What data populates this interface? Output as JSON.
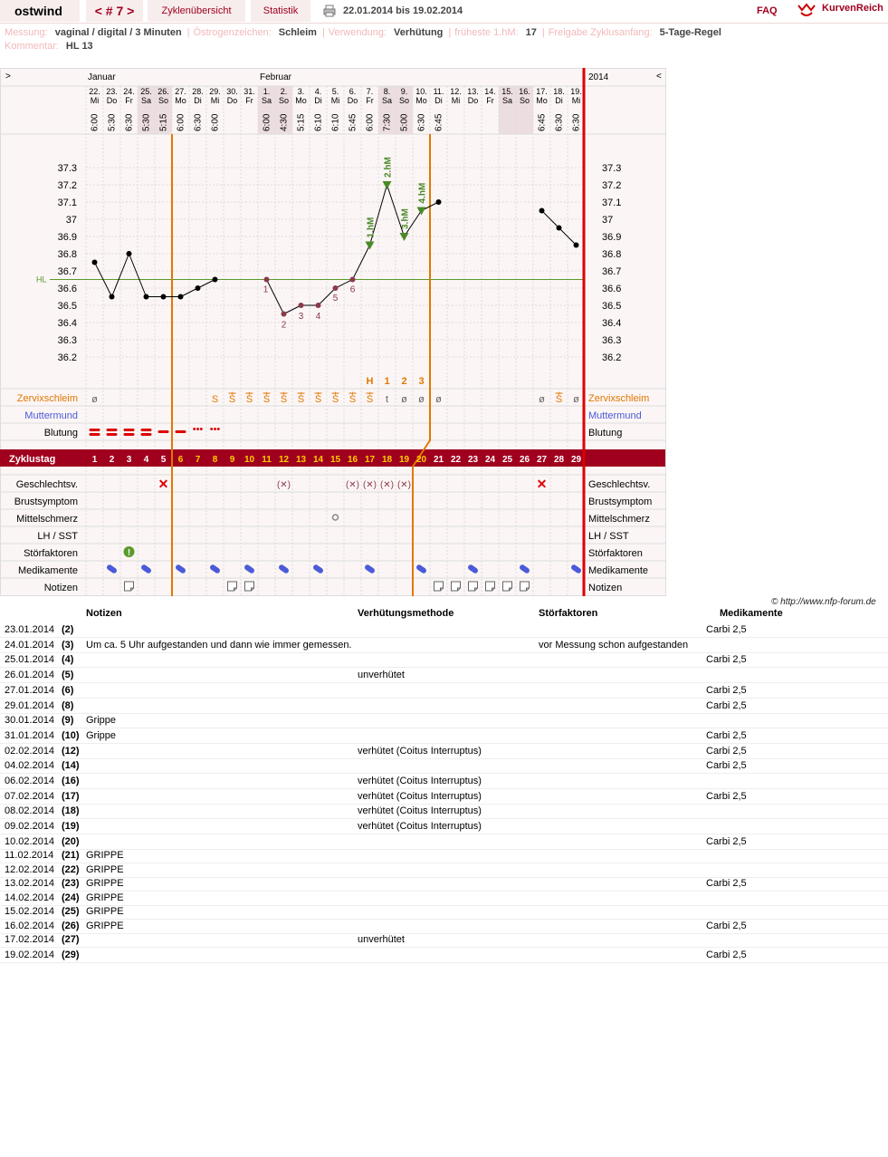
{
  "topbar": {
    "user": "ostwind",
    "cycle_prev": "<",
    "cycle_label": "# 7",
    "cycle_next": ">",
    "tab_overview": "Zyklenübersicht",
    "tab_stats": "Statistik",
    "date_range": "22.01.2014 bis 19.02.2014",
    "faq": "FAQ",
    "logo_text": "KurvenReich"
  },
  "info": {
    "messung_label": "Messung:",
    "messung_value": "vaginal / digital / 3 Minuten",
    "oestro_label": "Östrogenzeichen:",
    "oestro_value": "Schleim",
    "verwendung_label": "Verwendung:",
    "verwendung_value": "Verhütung",
    "hm_label": "früheste 1.hM:",
    "hm_value": "17",
    "freigabe_label": "Freigabe Zyklusanfang:",
    "freigabe_value": "5-Tage-Regel",
    "kommentar_label": "Kommentar:",
    "kommentar_value": "HL 13"
  },
  "chart_data": {
    "type": "line",
    "year_label": "2014",
    "nav_left": ">",
    "nav_right": "<",
    "months": [
      {
        "label": "Januar",
        "day_index": 0
      },
      {
        "label": "Februar",
        "day_index": 10
      }
    ],
    "dates": [
      "22.",
      "23.",
      "24.",
      "25.",
      "26.",
      "27.",
      "28.",
      "29.",
      "30.",
      "31.",
      "1.",
      "2.",
      "3.",
      "4.",
      "5.",
      "6.",
      "7.",
      "8.",
      "9.",
      "10.",
      "11.",
      "12.",
      "13.",
      "14.",
      "15.",
      "16.",
      "17.",
      "18.",
      "19."
    ],
    "weekdays": [
      "Mi",
      "Do",
      "Fr",
      "Sa",
      "So",
      "Mo",
      "Di",
      "Mi",
      "Do",
      "Fr",
      "Sa",
      "So",
      "Mo",
      "Di",
      "Mi",
      "Do",
      "Fr",
      "Sa",
      "So",
      "Mo",
      "Di",
      "Mi",
      "Do",
      "Fr",
      "Sa",
      "So",
      "Mo",
      "Di",
      "Mi"
    ],
    "weekend": [
      false,
      false,
      false,
      true,
      true,
      false,
      false,
      false,
      false,
      false,
      true,
      true,
      false,
      false,
      false,
      false,
      false,
      true,
      true,
      false,
      false,
      false,
      false,
      false,
      true,
      true,
      false,
      false,
      false
    ],
    "times": [
      "6:00",
      "5:30",
      "6:30",
      "5:30",
      "5:15",
      "6:00",
      "6:30",
      "6:00",
      "",
      "",
      "6:00",
      "4:30",
      "5:15",
      "6:10",
      "6:10",
      "5:45",
      "6:00",
      "7:30",
      "5:00",
      "6:30",
      "6:45",
      "",
      "",
      "",
      "",
      "",
      "6:45",
      "6:30",
      "6:30"
    ],
    "temps": [
      36.75,
      36.55,
      36.8,
      36.55,
      36.55,
      36.55,
      36.6,
      36.65,
      null,
      null,
      36.65,
      36.45,
      36.5,
      36.5,
      36.6,
      36.65,
      36.85,
      37.2,
      36.9,
      37.05,
      37.1,
      null,
      null,
      null,
      null,
      null,
      37.05,
      36.95,
      36.85
    ],
    "low_days": [
      10,
      11,
      12,
      13,
      14,
      15
    ],
    "low_labels": [
      "1",
      "2",
      "3",
      "4",
      "5",
      "6"
    ],
    "high_measurements": [
      {
        "day": 16,
        "label": "1.hM"
      },
      {
        "day": 17,
        "label": "2.hM"
      },
      {
        "day": 18,
        "label": "3.hM"
      },
      {
        "day": 19,
        "label": "4.hM"
      }
    ],
    "y_ticks": [
      37.3,
      37.2,
      37.1,
      37,
      36.9,
      36.8,
      36.7,
      36.6,
      36.5,
      36.4,
      36.3,
      36.2
    ],
    "y_tick_labels": [
      "37.3",
      "37.2",
      "37.1",
      "37",
      "36.9",
      "36.8",
      "36.7",
      "36.6",
      "36.5",
      "36.4",
      "36.3",
      "36.2"
    ],
    "ylim": [
      36.1,
      37.5
    ],
    "coverline": 36.65,
    "coverline_label": "HL",
    "evaluation_marks": [
      {
        "day": 16,
        "label": "H"
      },
      {
        "day": 17,
        "label": "1"
      },
      {
        "day": 18,
        "label": "2"
      },
      {
        "day": 19,
        "label": "3"
      }
    ],
    "row_labels": {
      "zervix": "Zervixschleim",
      "muttermund": "Muttermund",
      "blutung": "Blutung",
      "zyklustag": "Zyklustag",
      "gv": "Geschlechtsv.",
      "brust": "Brustsymptom",
      "mittel": "Mittelschmerz",
      "lh": "LH / SST",
      "stoer": "Störfaktoren",
      "medi": "Medikamente",
      "notizen": "Notizen"
    },
    "cervix": [
      "ø",
      "",
      "",
      "",
      "",
      "",
      "",
      "S",
      "S+",
      "S+",
      "S+",
      "S+",
      "S+",
      "S+",
      "S+",
      "S+",
      "S+",
      "t",
      "ø",
      "ø",
      "ø",
      "",
      "",
      "",
      "",
      "",
      "ø",
      "S+",
      "ø"
    ],
    "bleeding": [
      "strong",
      "strong",
      "strong",
      "strong",
      "medium",
      "medium",
      "light",
      "light",
      "",
      "",
      "",
      "",
      "",
      "",
      "",
      "",
      "",
      "",
      "",
      "",
      "",
      "",
      "",
      "",
      "",
      "",
      "",
      "",
      ""
    ],
    "cycle_days": [
      "1",
      "2",
      "3",
      "4",
      "5",
      "6",
      "7",
      "8",
      "9",
      "10",
      "11",
      "12",
      "13",
      "14",
      "15",
      "16",
      "17",
      "18",
      "19",
      "20",
      "21",
      "22",
      "23",
      "24",
      "25",
      "26",
      "27",
      "28",
      "29"
    ],
    "cycle_day_highlight": [
      false,
      false,
      false,
      false,
      false,
      true,
      true,
      true,
      true,
      true,
      true,
      true,
      true,
      true,
      true,
      true,
      true,
      true,
      true,
      true,
      false,
      false,
      false,
      false,
      false,
      false,
      false,
      false,
      false
    ],
    "intercourse": [
      "",
      "",
      "",
      "",
      "x",
      "",
      "",
      "",
      "",
      "",
      "",
      "(x)",
      "",
      "",
      "",
      "(x)",
      "(x)",
      "(x)",
      "(x)",
      "",
      "",
      "",
      "",
      "",
      "",
      "",
      "x",
      "",
      ""
    ],
    "mittelschmerz": [
      "",
      "",
      "",
      "",
      "",
      "",
      "",
      "",
      "",
      "",
      "",
      "",
      "",
      "",
      "1",
      "",
      "",
      "",
      "",
      "",
      "",
      "",
      "",
      "",
      "",
      "",
      "",
      "",
      ""
    ],
    "stoerfaktoren": [
      "",
      "",
      "1",
      "",
      "",
      "",
      "",
      "",
      "",
      "",
      "",
      "",
      "",
      "",
      "",
      "",
      "",
      "",
      "",
      "",
      "",
      "",
      "",
      "",
      "",
      "",
      "",
      "",
      ""
    ],
    "medikamente": [
      "",
      "1",
      "",
      "1",
      "",
      "1",
      "",
      "1",
      "",
      "1",
      "",
      "1",
      "",
      "1",
      "",
      "",
      "1",
      "",
      "",
      "1",
      "",
      "",
      "1",
      "",
      "",
      "1",
      "",
      "",
      "1"
    ],
    "notizen": [
      "",
      "",
      "1",
      "",
      "",
      "",
      "",
      "",
      "1",
      "1",
      "",
      "",
      "",
      "",
      "",
      "",
      "",
      "",
      "",
      "",
      "1",
      "1",
      "1",
      "1",
      "1",
      "1",
      "",
      "",
      ""
    ],
    "colors": {
      "temp_line": "#000000",
      "coverline": "#5a9a2a",
      "evaluation": "#e07800",
      "cycle_bar": "#a0001e",
      "high_measure": "#4a8a2a",
      "low_points": "#8a3a4a",
      "medication": "#4a5ad8"
    }
  },
  "notes_table": {
    "copyright": "© http://www.nfp-forum.de",
    "headers": {
      "notes": "Notizen",
      "method": "Verhütungsmethode",
      "disturb": "Störfaktoren",
      "meds": "Medikamente"
    },
    "rows": [
      {
        "date": "23.01.2014",
        "day": "(2)",
        "note": "",
        "method": "",
        "disturb": "",
        "meds": "Carbi 2,5"
      },
      {
        "date": "24.01.2014",
        "day": "(3)",
        "note": "Um ca. 5 Uhr aufgestanden und dann wie immer gemessen.",
        "method": "",
        "disturb": "vor Messung schon aufgestanden",
        "meds": ""
      },
      {
        "date": "25.01.2014",
        "day": "(4)",
        "note": "",
        "method": "",
        "disturb": "",
        "meds": "Carbi 2,5"
      },
      {
        "date": "26.01.2014",
        "day": "(5)",
        "note": "",
        "method": "unverhütet",
        "disturb": "",
        "meds": ""
      },
      {
        "date": "27.01.2014",
        "day": "(6)",
        "note": "",
        "method": "",
        "disturb": "",
        "meds": "Carbi 2,5"
      },
      {
        "date": "29.01.2014",
        "day": "(8)",
        "note": "",
        "method": "",
        "disturb": "",
        "meds": "Carbi 2,5"
      },
      {
        "date": "30.01.2014",
        "day": "(9)",
        "note": "Grippe",
        "method": "",
        "disturb": "",
        "meds": ""
      },
      {
        "date": "31.01.2014",
        "day": "(10)",
        "note": "Grippe",
        "method": "",
        "disturb": "",
        "meds": "Carbi 2,5"
      },
      {
        "date": "02.02.2014",
        "day": "(12)",
        "note": "",
        "method": "verhütet (Coitus Interruptus)",
        "disturb": "",
        "meds": "Carbi 2,5"
      },
      {
        "date": "04.02.2014",
        "day": "(14)",
        "note": "",
        "method": "",
        "disturb": "",
        "meds": "Carbi 2,5"
      },
      {
        "date": "06.02.2014",
        "day": "(16)",
        "note": "",
        "method": "verhütet (Coitus Interruptus)",
        "disturb": "",
        "meds": ""
      },
      {
        "date": "07.02.2014",
        "day": "(17)",
        "note": "",
        "method": "verhütet (Coitus Interruptus)",
        "disturb": "",
        "meds": "Carbi 2,5"
      },
      {
        "date": "08.02.2014",
        "day": "(18)",
        "note": "",
        "method": "verhütet (Coitus Interruptus)",
        "disturb": "",
        "meds": ""
      },
      {
        "date": "09.02.2014",
        "day": "(19)",
        "note": "",
        "method": "verhütet (Coitus Interruptus)",
        "disturb": "",
        "meds": ""
      },
      {
        "date": "10.02.2014",
        "day": "(20)",
        "note": "",
        "method": "",
        "disturb": "",
        "meds": "Carbi 2,5"
      },
      {
        "date": "11.02.2014",
        "day": "(21)",
        "note": "GRIPPE",
        "method": "",
        "disturb": "",
        "meds": ""
      },
      {
        "date": "12.02.2014",
        "day": "(22)",
        "note": "GRIPPE",
        "method": "",
        "disturb": "",
        "meds": ""
      },
      {
        "date": "13.02.2014",
        "day": "(23)",
        "note": "GRIPPE",
        "method": "",
        "disturb": "",
        "meds": "Carbi 2,5"
      },
      {
        "date": "14.02.2014",
        "day": "(24)",
        "note": "GRIPPE",
        "method": "",
        "disturb": "",
        "meds": ""
      },
      {
        "date": "15.02.2014",
        "day": "(25)",
        "note": "GRIPPE",
        "method": "",
        "disturb": "",
        "meds": ""
      },
      {
        "date": "16.02.2014",
        "day": "(26)",
        "note": "GRIPPE",
        "method": "",
        "disturb": "",
        "meds": "Carbi 2,5"
      },
      {
        "date": "17.02.2014",
        "day": "(27)",
        "note": "",
        "method": "unverhütet",
        "disturb": "",
        "meds": ""
      },
      {
        "date": "19.02.2014",
        "day": "(29)",
        "note": "",
        "method": "",
        "disturb": "",
        "meds": "Carbi 2,5"
      }
    ]
  }
}
